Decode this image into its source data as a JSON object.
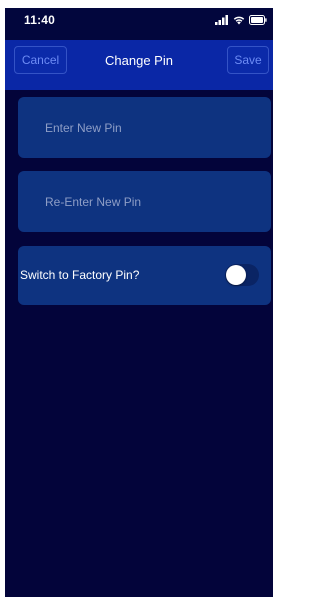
{
  "status_bar": {
    "time": "11:40",
    "icons": [
      "signal-icon",
      "wifi-icon",
      "battery-icon"
    ]
  },
  "nav": {
    "cancel_label": "Cancel",
    "title": "Change Pin",
    "save_label": "Save"
  },
  "form": {
    "new_pin_placeholder": "Enter New Pin",
    "new_pin_value": "",
    "reenter_pin_placeholder": "Re-Enter New Pin",
    "reenter_pin_value": "",
    "factory_pin_label": "Switch to Factory Pin?",
    "factory_pin_enabled": false
  },
  "colors": {
    "background": "#03043a",
    "nav_bar": "#0a27a6",
    "card": "#0e3380",
    "button_text": "#6d8cf5"
  }
}
